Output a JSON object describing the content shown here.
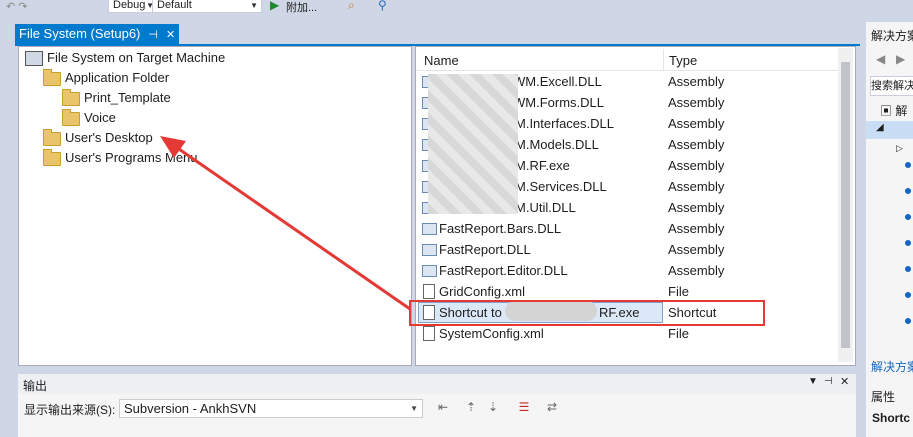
{
  "toolbar": {
    "config": "Debug",
    "platform": "Default",
    "run_label": "附加..."
  },
  "doc_tab": {
    "title": "File System (Setup6)",
    "pin": "⊣",
    "close": "✕"
  },
  "tree": {
    "items": [
      {
        "label": "File System on Target Machine"
      },
      {
        "label": "Application Folder"
      },
      {
        "label": "Print_Template"
      },
      {
        "label": "Voice"
      },
      {
        "label": "User's Desktop"
      },
      {
        "label": "User's Programs Menu"
      }
    ]
  },
  "list": {
    "col_name": "Name",
    "col_type": "Type",
    "rows": [
      {
        "name": "WM.Excell.DLL",
        "type": "Assembly"
      },
      {
        "name": "WM.Forms.DLL",
        "type": "Assembly"
      },
      {
        "name": "M.Interfaces.DLL",
        "type": "Assembly"
      },
      {
        "name": "M.Models.DLL",
        "type": "Assembly"
      },
      {
        "name": "M.RF.exe",
        "type": "Assembly"
      },
      {
        "name": "M.Services.DLL",
        "type": "Assembly"
      },
      {
        "name": "M.Util.DLL",
        "type": "Assembly"
      },
      {
        "name": "FastReport.Bars.DLL",
        "type": "Assembly"
      },
      {
        "name": "FastReport.DLL",
        "type": "Assembly"
      },
      {
        "name": "FastReport.Editor.DLL",
        "type": "Assembly"
      },
      {
        "name": "GridConfig.xml",
        "type": "File"
      },
      {
        "name": "Shortcut to",
        "name_tail": "RF.exe",
        "type": "Shortcut"
      },
      {
        "name": "SystemConfig.xml",
        "type": "File"
      }
    ]
  },
  "output": {
    "title": "输出",
    "source_label": "显示输出来源(S):",
    "source_value": "Subversion - AnkhSVN"
  },
  "solution": {
    "title": "解决方案",
    "search": "搜索解决",
    "item": "解",
    "bottom_title": "解决方案",
    "properties": "属性",
    "prop_value": "Shortc"
  },
  "colors": {
    "accent": "#007acc",
    "annotation": "#e53935"
  }
}
